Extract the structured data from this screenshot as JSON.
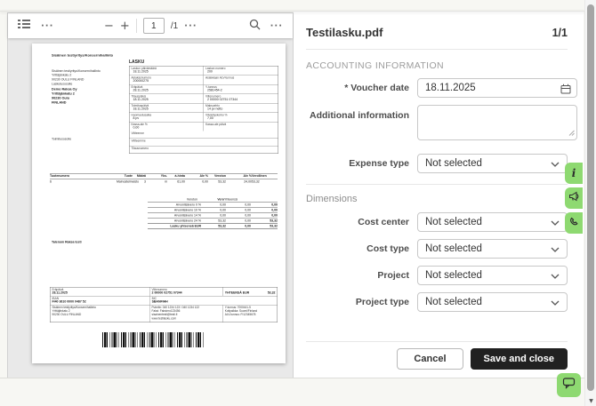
{
  "colors": {
    "accent_green": "#8ed971",
    "dark_button": "#212121"
  },
  "icons": {
    "sidebar_toggle": "thumbnail-list",
    "more": "ellipsis",
    "search": "magnifier",
    "calendar": "calendar",
    "chevron": "chevron-down",
    "info_tab": "i",
    "announce_tab": "megaphone",
    "call_tab": "phone",
    "chat": "chat-bubble",
    "scroll_down_glyph": "▼"
  },
  "toolbar": {
    "more_glyph": "···",
    "zoom_out": "−",
    "zoom_in": "+",
    "page_current": "1",
    "page_total": "/1"
  },
  "panel": {
    "title": "Testilasku.pdf",
    "page_indicator": "1/1",
    "section_accounting": "ACCOUNTING INFORMATION",
    "section_dimensions": "Dimensions",
    "fields": {
      "voucher_date": {
        "label": "* Voucher date",
        "value": "18.11.2025"
      },
      "additional_info": {
        "label": "Additional information",
        "value": ""
      },
      "expense_type": {
        "label": "Expense type",
        "value": "Not selected"
      }
    },
    "dimension_fields": [
      {
        "label": "Cost center",
        "value": "Not selected"
      },
      {
        "label": "Cost type",
        "value": "Not selected"
      },
      {
        "label": "Project",
        "value": "Not selected"
      },
      {
        "label": "Project type",
        "value": "Not selected"
      }
    ],
    "buttons": {
      "cancel": "Cancel",
      "save": "Save and close"
    }
  },
  "invoice": {
    "company_header": "Sisäinen testiyritys/Konsernihallinto",
    "doc_title": "LASKU",
    "sender_address": [
      "Sisäinen testiyritys/Konsernihallinto",
      "Yrittäjänkatu 2",
      "90230 OULU FINLAND"
    ],
    "billing_label": "Laskutusosoite",
    "billing_address": [
      "Demo Raksa Oy",
      "Yrittäjänkatu 2",
      "90230 Oulu",
      "FINLAND"
    ],
    "shipping_label": "Toimitusosoite",
    "info_rows": [
      {
        "l1": "Laskun päivämäärä",
        "v1": "18.11.2025",
        "l2": "Laskun numero",
        "v2": "200"
      },
      {
        "l1": "Asiakasnumero",
        "v1": "200000275",
        "l2": "Asiakkaan ALV-tunnus",
        "v2": ""
      },
      {
        "l1": "Eräpäivä",
        "v1": "28.11.2025",
        "l2": "Y-tunnus",
        "v2": "2581454-2"
      },
      {
        "l1": "Tilauspäivä",
        "v1": "18.11.2025",
        "l2": "Viitenumero",
        "v2": "2 00000 02751 07344"
      },
      {
        "l1": "Toimituspäivä",
        "v1": "18.11.2025",
        "l2": "Maksuehto",
        "v2": "14 pv netto"
      },
      {
        "l1": "Huomautusaika",
        "v1": "8 pv",
        "l2": "Viivästyskorko %",
        "v2": "7,00"
      },
      {
        "l1": "Kassa-ale %",
        "v1": "0,00",
        "l2": "Kassa-ale päivä",
        "v2": ""
      }
    ],
    "info_single_rows": [
      "Viitteenne",
      "Viitteemme",
      "Tilausnumero"
    ],
    "items_header": [
      "Tuotenumero",
      "Tuote",
      "Määrä",
      "Yks.",
      "á-hinta",
      "Ale %",
      "Veroton",
      "Alv %",
      "Verollinen"
    ],
    "item_row": [
      "6",
      "Mainostelineisto",
      "3",
      "m",
      "61,00",
      "0,00",
      "53,32",
      "24,00",
      "53,32"
    ],
    "vat_header": [
      "",
      "Veroton",
      "Vero",
      "Yhteensä"
    ],
    "vat_rows": [
      {
        "label": "Arvonlisävero 0 %",
        "veroton": "0,00",
        "vero": "0,00",
        "total": "0,00"
      },
      {
        "label": "Arvonlisävero 10 %",
        "veroton": "0,00",
        "vero": "0,00",
        "total": "0,00"
      },
      {
        "label": "Arvonlisävero 14 %",
        "veroton": "0,00",
        "vero": "0,00",
        "total": "0,00"
      },
      {
        "label": "Arvonlisävero 24 %",
        "veroton": "53,32",
        "vero": "0,00",
        "total": "53,32"
      },
      {
        "label": "Lasku yhteensä EUR",
        "veroton": "53,32",
        "vero": "0,00",
        "total": "53,32"
      }
    ],
    "note": "Talenom Raksa testi",
    "footer": {
      "due_label": "Eräpäivä",
      "due_value": "28.11.2025",
      "ref_label": "Viitenumero",
      "ref_value": "2 00000 02751 07344",
      "total_label": "YHTEENSÄ EUR",
      "total_value": "53,32",
      "iban_label": "IBAN",
      "iban_value": "FI40 3610 0000 0487 52",
      "bic_label": "BIC",
      "bic_value": "SBANFIHH",
      "company_lines": [
        "Sisäinen testiyritys/Konsernihallinto",
        "Yrittäjänkatu 2",
        "90230 OULU FINLAND"
      ],
      "contact_lines": [
        "Puhelin: 040 1234 123 / 040 1234 122",
        "Faksi: Faksinro123456",
        "sisainentesti@testi.fi",
        "www.testilasku.com"
      ],
      "company_id_lines": [
        "Y-tunnus: 7000441-5",
        "Kotipaikka: Suomi/Finland",
        "ALV-tunnus: FI12345678"
      ]
    }
  }
}
